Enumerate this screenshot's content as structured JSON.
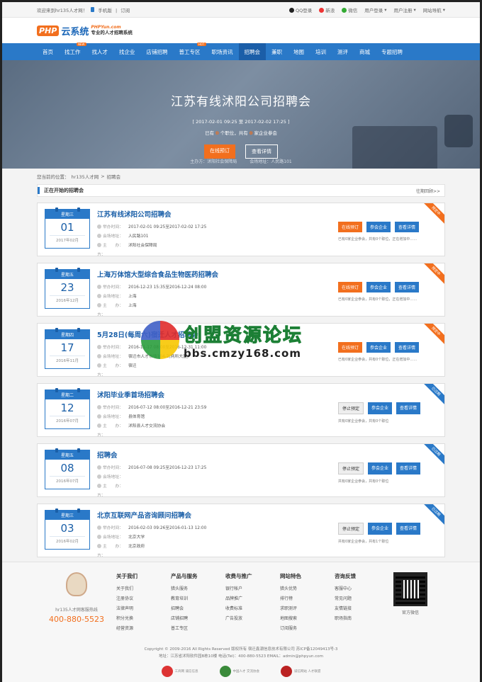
{
  "topbar": {
    "welcome": "欢迎来到hr135人才网！",
    "mobile": "手机版",
    "subscribe": "订阅",
    "links": [
      "QQ登录",
      "新浪",
      "微信",
      "用户登录",
      "用户注册",
      "网站导航"
    ]
  },
  "logo": {
    "brand": "PHP",
    "name": "云系统",
    "url": "PHPYun.com",
    "slogan": "专业的人才招聘系统"
  },
  "nav": {
    "items": [
      "首页",
      "找工作",
      "找人才",
      "找企业",
      "店铺招聘",
      "普工专区",
      "职场资讯",
      "招聘会",
      "兼职",
      "地图",
      "培训",
      "测评",
      "商城",
      "专题招聘"
    ],
    "badge_new": "NEW",
    "badge_hot": "HOT",
    "active_index": 7
  },
  "banner": {
    "title": "江苏有线沭阳公司招聘会",
    "time": "[ 2017-02-01 09:25 至 2017-02-02 17:25 ]",
    "stat_prefix": "已有",
    "stat_jobs": "0",
    "stat_mid": "个职位，共有",
    "stat_companies": "0",
    "stat_suffix": "家企业参会",
    "btn_book": "在线预订",
    "btn_detail": "查看详情",
    "host": "主办方：沭阳社会保障局",
    "venue": "会场地址：人民路101"
  },
  "breadcrumb": {
    "label": "您当前的位置：",
    "home": "hr135人才网",
    "sep": ">",
    "current": "招聘会"
  },
  "section": {
    "title": "正在开始的招聘会",
    "more": "往期回顾>>"
  },
  "fair_labels": {
    "time": "举办时间：",
    "venue": "会场地址：",
    "host": "主　　办：",
    "organizer": "方：",
    "book": "在线预订",
    "stop": "停止预定",
    "join": "参会企业",
    "detail": "查看详情",
    "running": "预定中",
    "ended": "已过期"
  },
  "fairs": [
    {
      "weekday": "星期三",
      "day": "01",
      "ym": "2017年02月",
      "title": "江苏有线沭阳公司招聘会",
      "time": "2017-02-01 09:25至2017-02-02 17:25",
      "venue": "人民路101",
      "host": "沭阳社会保障局",
      "status": "running",
      "note": "已有0家企业参会，共有0个职位，正在增加中……"
    },
    {
      "weekday": "星期五",
      "day": "23",
      "ym": "2016年12月",
      "title": "上海万体馆大型综合食品生物医药招聘会",
      "time": "2016-12-23 15:35至2016-12-24 08:00",
      "venue": "上海",
      "host": "上海",
      "status": "running",
      "note": "已有0家企业参会，共有0个职位，正在增加中……"
    },
    {
      "weekday": "星期四",
      "day": "17",
      "ym": "2016年11月",
      "title": "5月28日(每周六)宿迁人才招聘会",
      "time": "2016-11-17 08:00至2016-12-31 11:00",
      "venue": "宿迁市人才市场104-2(两所大厦)",
      "host": "宿迁",
      "status": "running",
      "note": "已有0家企业参会，共有0个职位，正在增加中……"
    },
    {
      "weekday": "星期二",
      "day": "12",
      "ym": "2016年07月",
      "title": "沭阳毕业季首场招聘会",
      "time": "2016-07-12 08:00至2016-12-21 23:59",
      "venue": "县体育馆",
      "host": "沭阳县人才交流协会",
      "status": "ended",
      "note": "共有0家企业参会，共有0个职位"
    },
    {
      "weekday": "星期五",
      "day": "08",
      "ym": "2016年07月",
      "title": "招聘会",
      "time": "2016-07-08 09:25至2016-12-23 17:25",
      "venue": "",
      "host": "",
      "status": "ended",
      "note": "共有0家企业参会，共有0个职位"
    },
    {
      "weekday": "星期三",
      "day": "03",
      "ym": "2016年02月",
      "title": "北京互联网产品咨询顾问招聘会",
      "time": "2016-02-03 09:26至2016-01-13 12:00",
      "venue": "北京大学",
      "host": "北京政府",
      "status": "ended",
      "note": "共有0家企业参会，共有1个职位"
    }
  ],
  "watermark": {
    "cn": "创盟资源论坛",
    "url": "bbs.cmzy168.com"
  },
  "footer": {
    "service_name": "hr135人才网客服热线",
    "tel": "400-880-5523",
    "columns": [
      {
        "title": "关于我们",
        "items": [
          "关于我们",
          "注册协议",
          "法律声明",
          "积分兑换",
          "经营资源"
        ]
      },
      {
        "title": "产品与服务",
        "items": [
          "猎头服务",
          "教育培训",
          "招聘会",
          "店铺招聘",
          "普工专区"
        ]
      },
      {
        "title": "收费与推广",
        "items": [
          "银行帐户",
          "品牌推广",
          "收费标准",
          "广告投放"
        ]
      },
      {
        "title": "网站特色",
        "items": [
          "猎头优势",
          "排行榜",
          "求职测评",
          "地图搜索",
          "订阅服务"
        ]
      },
      {
        "title": "咨询反馈",
        "items": [
          "客服中心",
          "常见问题",
          "友情链接",
          "职场指南"
        ]
      }
    ],
    "qr_label": "官方微信",
    "copyright": "Copyright © 2009-2016 All Rights Reserved 版权所有 宿迁鑫潮信息技术有限公司 苏ICP备12049413号-3",
    "address": "地址：江苏省沭阳软件园B栋10楼 电话(Tel)：400-880-5523 EMAIL：admin@phpyun.com",
    "badges": [
      "工商网 诚信信息",
      "中国人才 交流协会",
      "诚信网站 人才联盟"
    ]
  }
}
